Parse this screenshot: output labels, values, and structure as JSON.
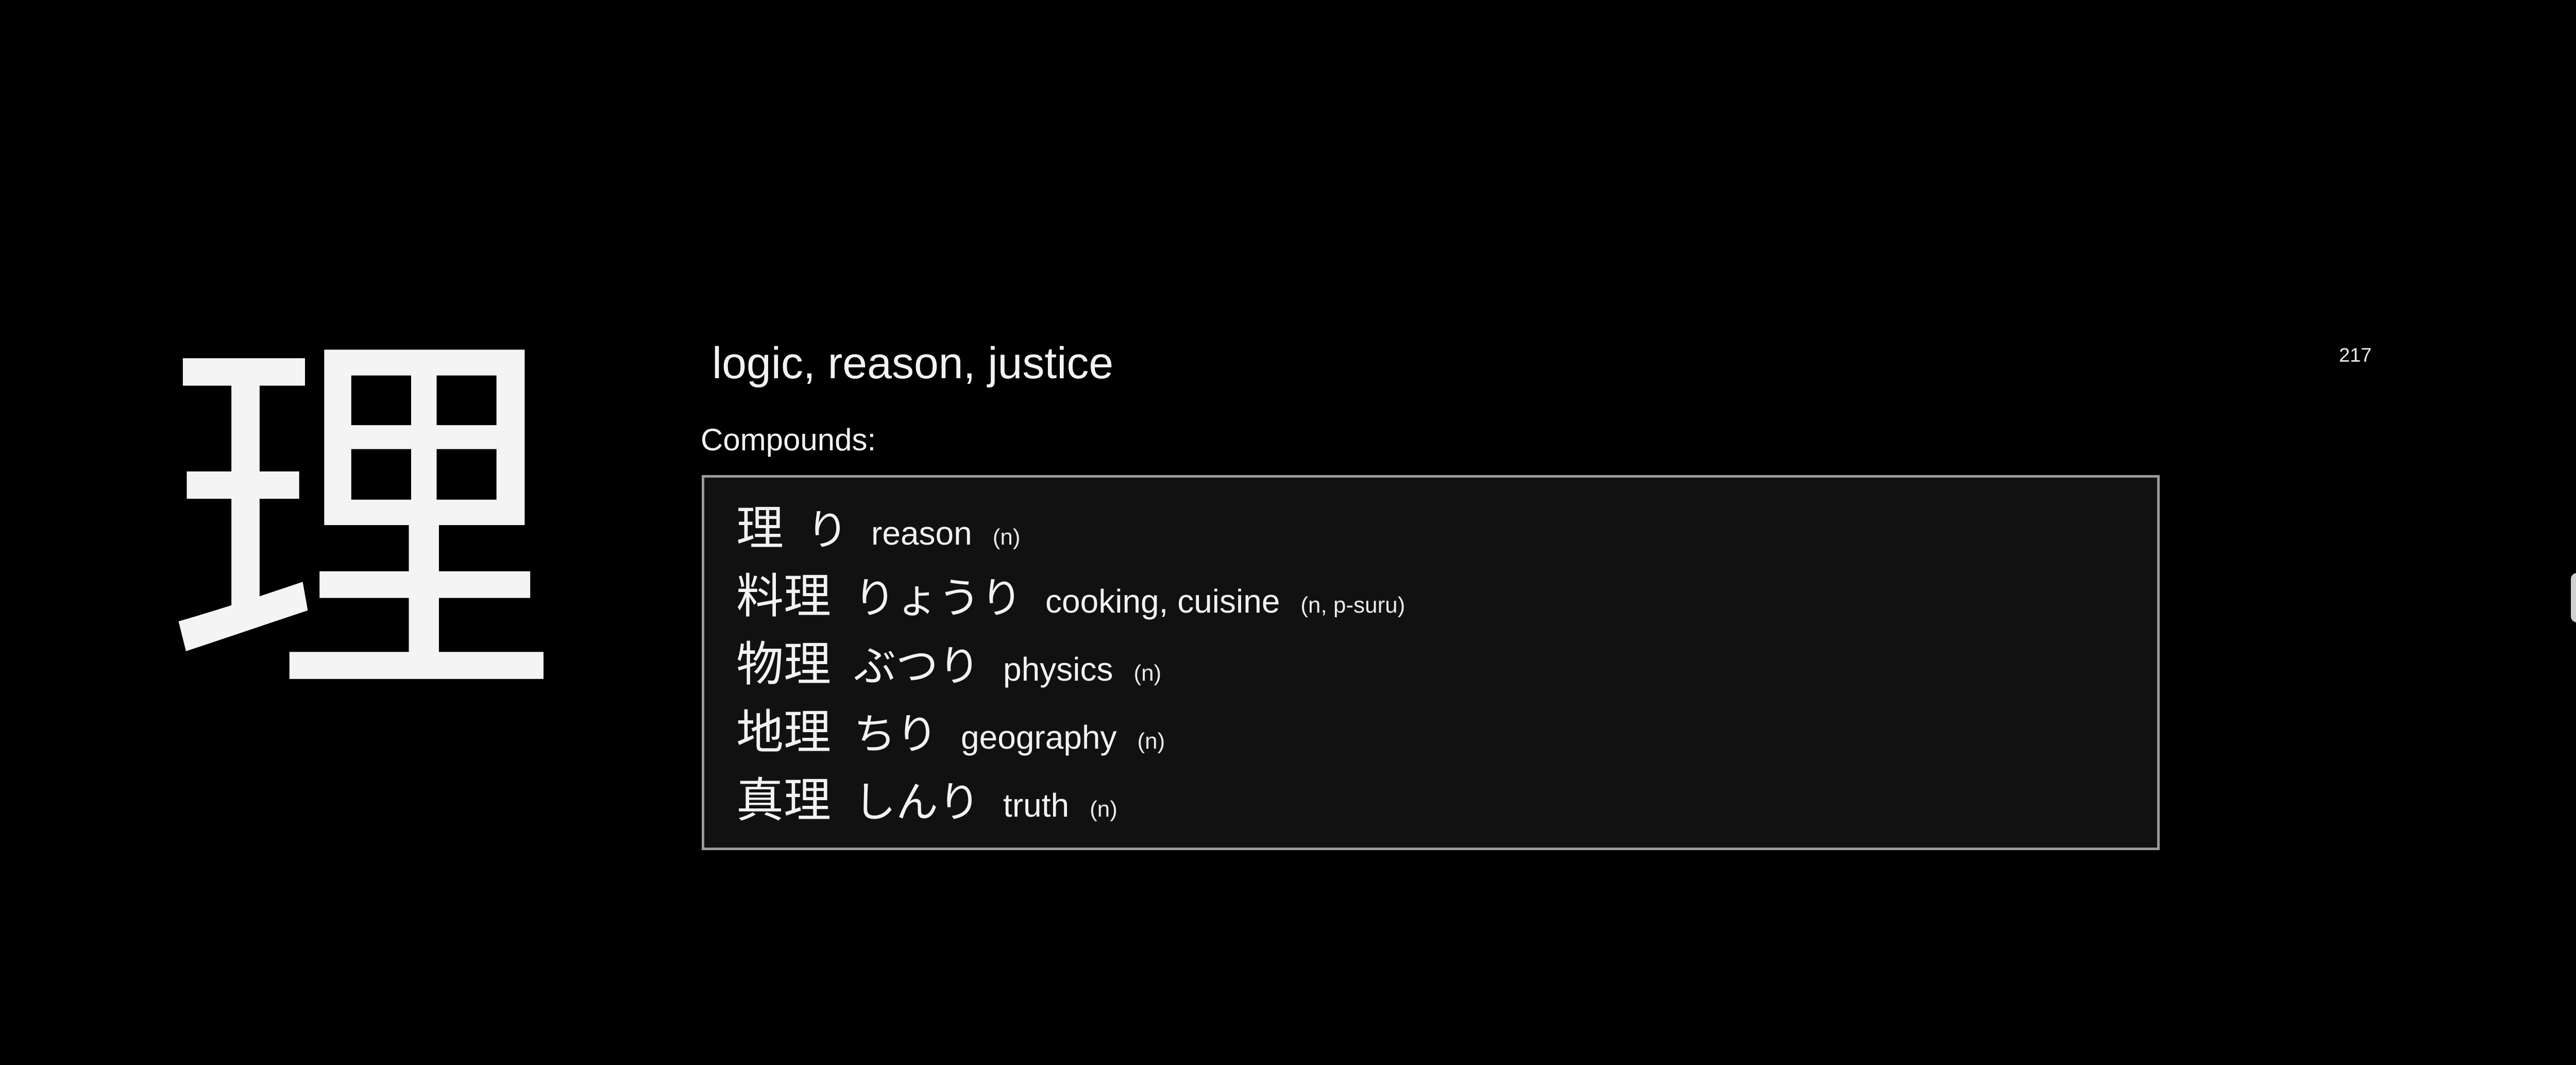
{
  "card": {
    "kanji": "理",
    "meaning": "logic, reason, justice",
    "frame_number": "217",
    "compounds_label": "Compounds:",
    "compounds": [
      {
        "word": "理",
        "reading": "り",
        "meaning": "reason",
        "pos": "(n)"
      },
      {
        "word": "料理",
        "reading": "りょうり",
        "meaning": "cooking, cuisine",
        "pos": "(n, p-suru)"
      },
      {
        "word": "物理",
        "reading": "ぶつり",
        "meaning": "physics",
        "pos": "(n)"
      },
      {
        "word": "地理",
        "reading": "ちり",
        "meaning": "geography",
        "pos": "(n)"
      },
      {
        "word": "真理",
        "reading": "しんり",
        "meaning": "truth",
        "pos": "(n)"
      }
    ]
  },
  "colors": {
    "background": "#000000",
    "text": "#f2f2f2",
    "box_background": "#111111",
    "box_border": "#9a9a9a"
  }
}
